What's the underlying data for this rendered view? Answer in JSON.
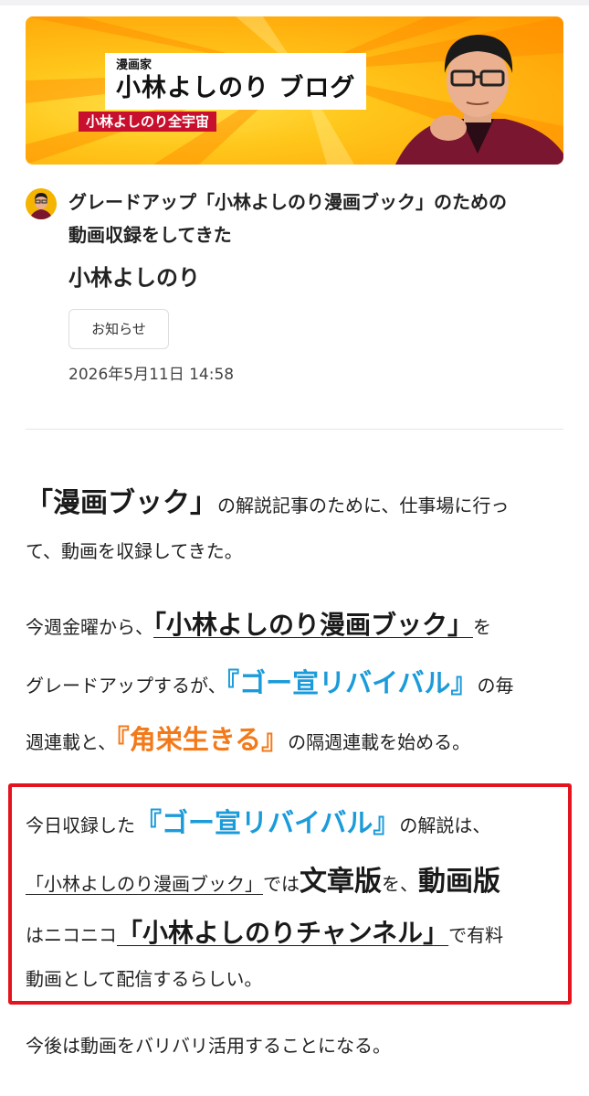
{
  "banner": {
    "subtitle": "漫画家",
    "title": "小林よしのり ブログ",
    "tagline": "小林よしのり全宇宙",
    "colors": {
      "background": "#ffc61a",
      "tagline_bg": "#c8102e"
    }
  },
  "post": {
    "title_line1": "グレードアップ「小林よしのり漫画ブック」のための",
    "title_line2": "動画収録をしてきた",
    "author": "小林よしのり",
    "category": "お知らせ",
    "date": "2026年5月11日 14:58"
  },
  "article": {
    "p1": {
      "l1_big": "「漫画ブック」",
      "l1_rest": "の解説記事のために、仕事場に行っ",
      "l2": "て、動画を収録してきた。"
    },
    "p2": {
      "l1_a": "今週金曜から、",
      "l1_big": "「小林よしのり漫画ブック」",
      "l1_b": "を",
      "l2_a": "グレードアップするが、",
      "l2_blue": "『ゴー宣リバイバル』",
      "l2_b": "の毎",
      "l3_a": "週連載と、",
      "l3_orange": "『角栄生きる』",
      "l3_b": "の隔週連載を始める。"
    },
    "p3": {
      "l1_a": "今日収録した",
      "l1_blue": "『ゴー宣リバイバル』",
      "l1_b": "の解説は、",
      "l2_u": "「小林よしのり漫画ブック」",
      "l2_a": "では",
      "l2_s1": "文章版",
      "l2_b": "を、",
      "l2_s2": "動画版",
      "l3_a": "はニコニコ",
      "l3_big": "「小林よしのりチャンネル」",
      "l3_b": "で有料",
      "l4": "動画として配信するらしい。"
    },
    "p4": "今後は動画をバリバリ活用することになる。",
    "colors": {
      "blue": "#1b9bd9",
      "orange": "#f27a1a",
      "highlight_border": "#e3141e"
    }
  }
}
